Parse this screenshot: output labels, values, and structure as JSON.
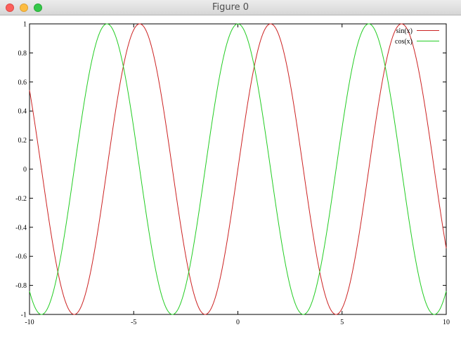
{
  "window": {
    "title": "Figure 0"
  },
  "chart_data": {
    "type": "line",
    "title": "",
    "xlabel": "",
    "ylabel": "",
    "xlim": [
      -10,
      10
    ],
    "ylim": [
      -1,
      1
    ],
    "x_ticks": [
      "-10",
      "-5",
      "0",
      "5",
      "10"
    ],
    "y_ticks": [
      "-1",
      "-0.8",
      "-0.6",
      "-0.4",
      "-0.2",
      "0",
      "0.2",
      "0.4",
      "0.6",
      "0.8",
      "1"
    ],
    "legend_position": "top-right",
    "grid": false,
    "series": [
      {
        "name": "sin(x)",
        "color": "#cc2222",
        "function": "sin"
      },
      {
        "name": "cos(x)",
        "color": "#22cc22",
        "function": "cos"
      }
    ]
  }
}
